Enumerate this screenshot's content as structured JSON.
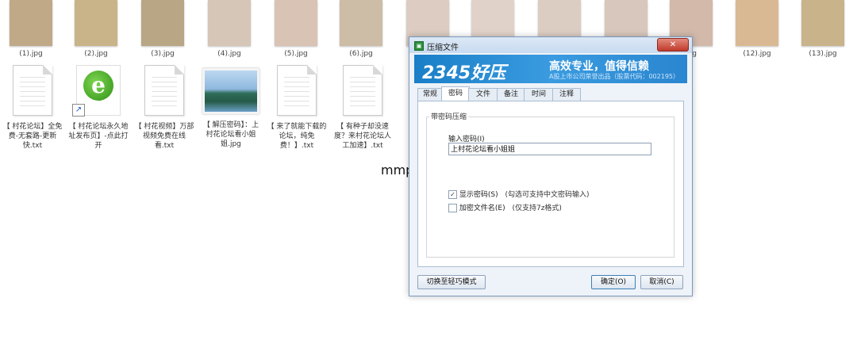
{
  "thumbnails": [
    {
      "label": "(1).jpg",
      "color": "#bfa987"
    },
    {
      "label": "(2).jpg",
      "color": "#c9b48a"
    },
    {
      "label": "(3).jpg",
      "color": "#b9a684"
    },
    {
      "label": "(4).jpg",
      "color": "#d6c6b7"
    },
    {
      "label": "(5).jpg",
      "color": "#d8c3b5"
    },
    {
      "label": "(6).jpg",
      "color": "#cdbca6"
    },
    {
      "label": "",
      "color": "#dcccc2"
    },
    {
      "label": "",
      "color": "#e1d2c9"
    },
    {
      "label": "",
      "color": "#dccdc3"
    },
    {
      "label": "",
      "color": "#d8c7bc"
    },
    {
      "label": "jpg",
      "color": "#d2b9aa"
    },
    {
      "label": "(12).jpg",
      "color": "#d9b993"
    },
    {
      "label": "(13).jpg",
      "color": "#c9b38b"
    }
  ],
  "files": [
    {
      "name": "【 村花论坛】全免费-无套路-更新快.txt",
      "type": "txt"
    },
    {
      "name": "【 村花论坛永久地址发布页】-点此打开",
      "type": "shortcut"
    },
    {
      "name": "【 村花视频】万部视频免费在线看.txt",
      "type": "txt"
    },
    {
      "name": "【 解压密码】：上村花论坛看小姐姐.jpg",
      "type": "image"
    },
    {
      "name": "【 来了就能下载的论坛，纯免费！】.txt",
      "type": "txt"
    },
    {
      "name": "【 有种子却没速度？来村花论坛人工加速】.txt",
      "type": "txt"
    }
  ],
  "watermark": "mmp233.xyz",
  "dialog": {
    "title": "压缩文件",
    "close_label": "✕",
    "banner_logo": "2345好压",
    "banner_slogan": "高效专业，值得信赖",
    "banner_sub": "A股上市公司荣誉出品（股票代码：002195）",
    "tabs": [
      "常规",
      "密码",
      "文件",
      "备注",
      "时间",
      "注释"
    ],
    "active_tab": 1,
    "group_title": "带密码压缩",
    "password_label": "输入密码(I)",
    "password_value": "上村花论坛看小姐姐",
    "show_password": {
      "label": "显示密码(S)",
      "note": "(勾选可支持中文密码输入)",
      "checked": true
    },
    "encrypt_names": {
      "label": "加密文件名(E)",
      "note": "(仅支持7z格式)",
      "checked": false
    },
    "switch_mode_button": "切换至轻巧模式",
    "ok_button": "确定(O)",
    "cancel_button": "取消(C)"
  }
}
